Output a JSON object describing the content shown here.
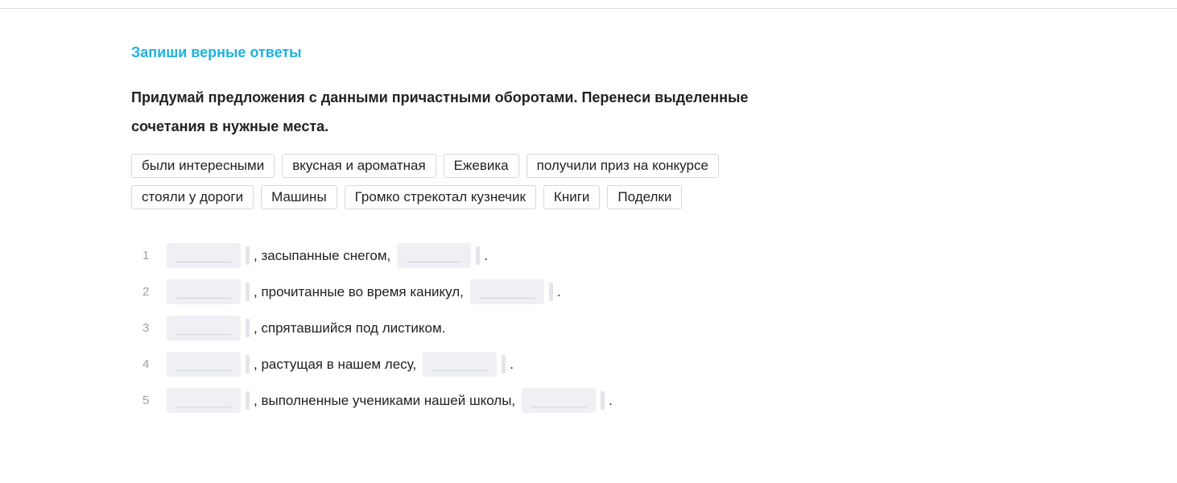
{
  "task": {
    "header": "Запиши верные ответы",
    "instruction_line1": "Придумай предложения с данными причастными оборотами. Перенеси выделенные",
    "instruction_line2": "сочетания в нужные места."
  },
  "word_bank": [
    "были интересными",
    "вкусная и ароматная",
    "Ежевика",
    "получили приз на конкурсе",
    "стояли у дороги",
    "Машины",
    "Громко стрекотал кузнечик",
    "Книги",
    "Поделки"
  ],
  "sentences": [
    {
      "num": "1",
      "middle": ", засыпанные снегом,",
      "end": "."
    },
    {
      "num": "2",
      "middle": ", прочитанные во время каникул,",
      "end": "."
    },
    {
      "num": "3",
      "middle": ", спрятавшийся под листиком.",
      "end": ""
    },
    {
      "num": "4",
      "middle": ", растущая в нашем лесу,",
      "end": "."
    },
    {
      "num": "5",
      "middle": ", выполненные учениками нашей школы,",
      "end": "."
    }
  ]
}
